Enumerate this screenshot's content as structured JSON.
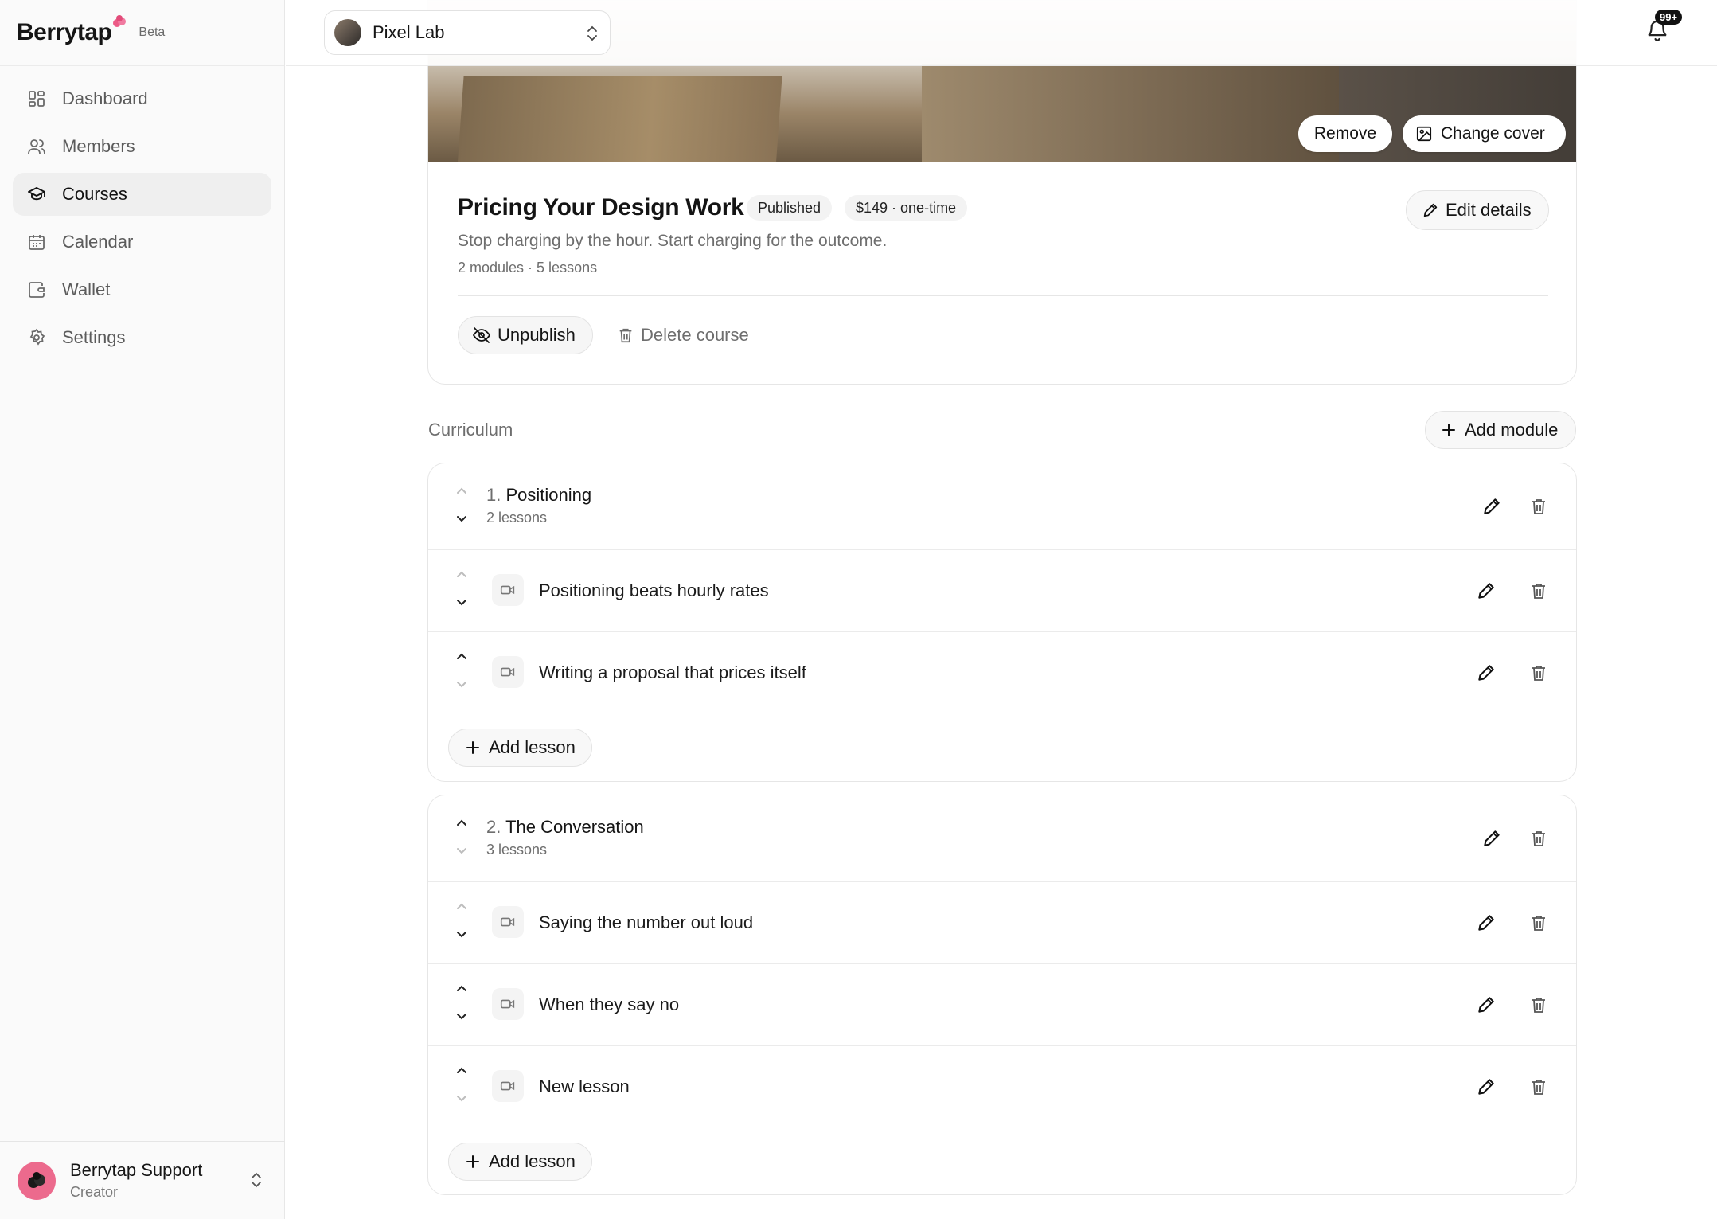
{
  "brand": {
    "name": "Berrytap",
    "badge": "Beta",
    "accent": "#ec5a86"
  },
  "sidebar": {
    "items": [
      {
        "label": "Dashboard",
        "icon": "dashboard-icon",
        "active": false
      },
      {
        "label": "Members",
        "icon": "members-icon",
        "active": false
      },
      {
        "label": "Courses",
        "icon": "courses-icon",
        "active": true
      },
      {
        "label": "Calendar",
        "icon": "calendar-icon",
        "active": false
      },
      {
        "label": "Wallet",
        "icon": "wallet-icon",
        "active": false
      },
      {
        "label": "Settings",
        "icon": "settings-icon",
        "active": false
      }
    ],
    "user": {
      "name": "Berrytap Support",
      "role": "Creator"
    }
  },
  "topbar": {
    "workspace": "Pixel Lab",
    "notifications": "99+"
  },
  "course": {
    "cover_actions": {
      "remove": "Remove",
      "change": "Change cover"
    },
    "title": "Pricing Your Design Work",
    "status": "Published",
    "price": "$149 · one-time",
    "edit_label": "Edit details",
    "subtitle": "Stop charging by the hour. Start charging for the outcome.",
    "meta": "2 modules · 5 lessons",
    "unpublish_label": "Unpublish",
    "delete_label": "Delete course"
  },
  "curriculum": {
    "label": "Curriculum",
    "add_module_label": "Add module",
    "add_lesson_label": "Add lesson",
    "modules": [
      {
        "number": "1.",
        "title": "Positioning",
        "count": "2 lessons",
        "lessons": [
          {
            "title": "Positioning beats hourly rates"
          },
          {
            "title": "Writing a proposal that prices itself"
          }
        ]
      },
      {
        "number": "2.",
        "title": "The Conversation",
        "count": "3 lessons",
        "lessons": [
          {
            "title": "Saying the number out loud"
          },
          {
            "title": "When they say no"
          },
          {
            "title": "New lesson"
          }
        ]
      }
    ]
  }
}
